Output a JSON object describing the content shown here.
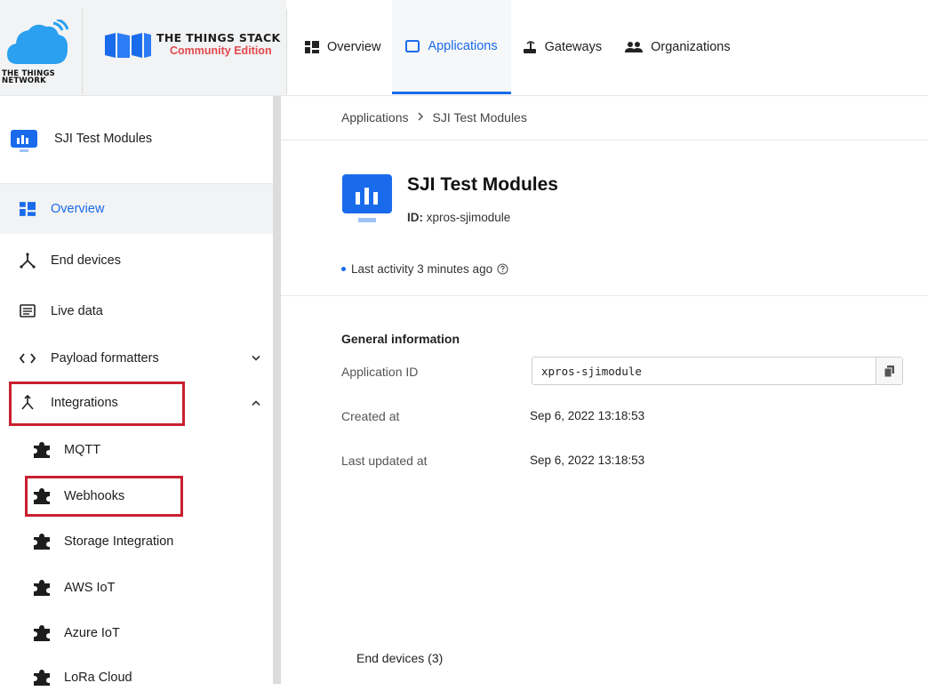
{
  "brand": {
    "ttn_text": [
      "THE THINGS",
      "NETWORK"
    ],
    "stack_title": "THE THINGS STACK",
    "stack_subtitle": "Community Edition",
    "accent_color": "#1a6bec",
    "edition_color": "#e04a4f"
  },
  "nav": {
    "items": [
      {
        "label": "Overview",
        "icon": "overview-grid-icon",
        "active": false
      },
      {
        "label": "Applications",
        "icon": "application-window-icon",
        "active": true
      },
      {
        "label": "Gateways",
        "icon": "gateway-icon",
        "active": false
      },
      {
        "label": "Organizations",
        "icon": "organization-people-icon",
        "active": false
      }
    ]
  },
  "sidebar": {
    "app_name": "SJI Test Modules",
    "items": [
      {
        "label": "Overview",
        "icon": "overview-grid-icon",
        "active": true
      },
      {
        "label": "End devices",
        "icon": "end-devices-icon"
      },
      {
        "label": "Live data",
        "icon": "live-data-icon"
      },
      {
        "label": "Payload formatters",
        "icon": "code-icon",
        "chevron": "down"
      },
      {
        "label": "Integrations",
        "icon": "integrations-icon",
        "chevron": "up"
      }
    ],
    "sub_items": [
      {
        "label": "MQTT",
        "icon": "puzzle-icon"
      },
      {
        "label": "Webhooks",
        "icon": "puzzle-icon"
      },
      {
        "label": "Storage Integration",
        "icon": "puzzle-icon"
      },
      {
        "label": "AWS IoT",
        "icon": "puzzle-icon"
      },
      {
        "label": "Azure IoT",
        "icon": "puzzle-icon"
      },
      {
        "label": "LoRa Cloud",
        "icon": "puzzle-icon"
      }
    ],
    "highlight_color": "#c8202f"
  },
  "breadcrumb": {
    "root": "Applications",
    "current": "SJI Test Modules"
  },
  "app": {
    "title": "SJI Test Modules",
    "id_label": "ID:",
    "id_value": "xpros-sjimodule",
    "activity": "Last activity 3 minutes ago"
  },
  "general": {
    "title": "General information",
    "fields": [
      {
        "label": "Application ID",
        "value": "xpros-sjimodule"
      },
      {
        "label": "Created at",
        "value": "Sep 6, 2022 13:18:53"
      },
      {
        "label": "Last updated at",
        "value": "Sep 6, 2022 13:18:53"
      }
    ]
  },
  "end_devices": {
    "label": "End devices (3)"
  }
}
